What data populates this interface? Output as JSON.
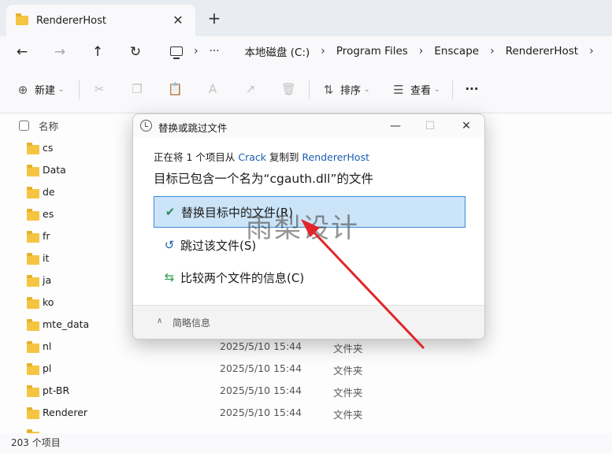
{
  "tab": {
    "title": "RendererHost",
    "close": "✕",
    "new": "+"
  },
  "nav": {
    "back": "←",
    "forward": "→",
    "up": "↑",
    "refresh": "↻",
    "more": "···",
    "sep": "›"
  },
  "breadcrumbs": [
    "本地磁盘 (C:)",
    "Program Files",
    "Enscape",
    "RendererHost"
  ],
  "toolbar": {
    "new_label": "新建",
    "sort_label": "排序",
    "view_label": "查看",
    "more": "···"
  },
  "list": {
    "header_name": "名称",
    "rows_top": [
      {
        "name": "cs"
      },
      {
        "name": "Data"
      },
      {
        "name": "de"
      },
      {
        "name": "es"
      },
      {
        "name": "fr"
      },
      {
        "name": "it"
      },
      {
        "name": "ja"
      },
      {
        "name": "ko"
      },
      {
        "name": "mte_data"
      }
    ],
    "rows_bottom": [
      {
        "name": "nl",
        "date": "2025/5/10 15:44",
        "type": "文件夹"
      },
      {
        "name": "pl",
        "date": "2025/5/10 15:44",
        "type": "文件夹"
      },
      {
        "name": "pt-BR",
        "date": "2025/5/10 15:44",
        "type": "文件夹"
      },
      {
        "name": "Renderer",
        "date": "2025/5/10 15:44",
        "type": "文件夹"
      }
    ]
  },
  "status": {
    "count": "203 个项目"
  },
  "dialog": {
    "title": "替换或跳过文件",
    "minimize": "—",
    "maximize": "☐",
    "close": "✕",
    "line1_prefix": "正在将 1 个项目从 ",
    "line1_src": "Crack",
    "line1_mid": " 复制到 ",
    "line1_dst": "RendererHost",
    "heading": "目标已包含一个名为“cgauth.dll”的文件",
    "option_replace": "替换目标中的文件(R)",
    "option_skip": "跳过该文件(S)",
    "option_compare": "比较两个文件的信息(C)",
    "footer": "简略信息"
  },
  "watermark": "雨梨设计",
  "colors": {
    "selection": "#cce4f7",
    "selection_border": "#3c8ad8",
    "link": "#1a5fb4",
    "arrow": "#e0262a"
  }
}
